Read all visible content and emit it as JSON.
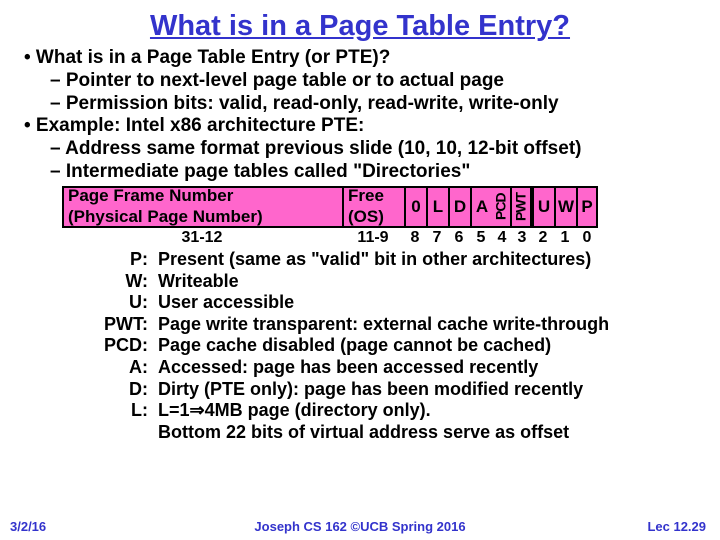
{
  "title": "What is in a Page Table Entry?",
  "bullet1": "• What is in a Page Table Entry (or PTE)?",
  "sub1a": "– Pointer to next-level page table or to actual page",
  "sub1b": "– Permission bits: valid, read-only, read-write, write-only",
  "bullet2": "• Example: Intel x86 architecture PTE:",
  "sub2a": "– Address same format previous slide (10, 10, 12-bit offset)",
  "sub2b": "– Intermediate page tables called \"Directories\"",
  "pfn1": "Page Frame Number",
  "pfn2": "(Physical Page Number)",
  "free1": "Free",
  "free2": "(OS)",
  "bits": [
    "0",
    "L",
    "D",
    "A",
    "PCD",
    "PWT",
    "U",
    "W",
    "P"
  ],
  "range_pfn": "31-12",
  "range_free": "11-9",
  "bit_nums": [
    "8",
    "7",
    "6",
    "5",
    "4",
    "3",
    "2",
    "1",
    "0"
  ],
  "defs": [
    {
      "k": "P:",
      "v": "Present (same as \"valid\" bit in other architectures)"
    },
    {
      "k": "W:",
      "v": "Writeable"
    },
    {
      "k": "U:",
      "v": "User accessible"
    },
    {
      "k": "PWT:",
      "v": "Page write transparent: external cache write-through"
    },
    {
      "k": "PCD:",
      "v": "Page cache disabled (page cannot be cached)"
    },
    {
      "k": "A:",
      "v": "Accessed: page has been accessed recently"
    },
    {
      "k": "D:",
      "v": "Dirty (PTE only): page has been modified recently"
    },
    {
      "k": "L:",
      "v": "L=1⇒4MB page (directory only)."
    },
    {
      "k": "",
      "v": "Bottom 22 bits of virtual address serve as offset"
    }
  ],
  "footer": {
    "date": "3/2/16",
    "mid": "Joseph CS 162 ©UCB Spring 2016",
    "lec": "Lec 12.29"
  }
}
